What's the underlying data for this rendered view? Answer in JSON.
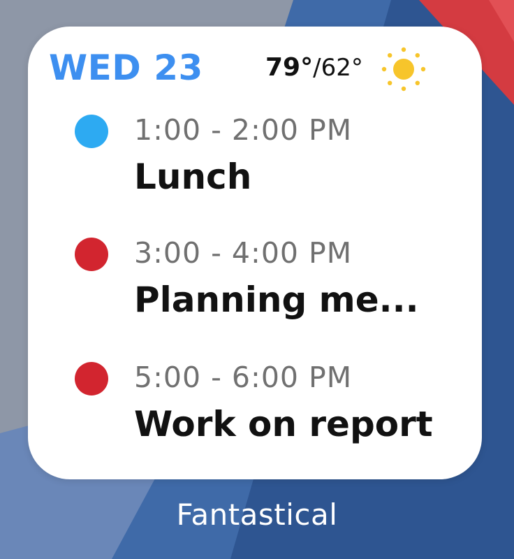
{
  "colors": {
    "accent": "#3d8ff0",
    "event_blue": "#2daaf2",
    "event_red": "#d2252f",
    "sun": "#f7c52b"
  },
  "widget": {
    "date": "WED 23",
    "weather": {
      "high": "79°",
      "low": "/62°",
      "icon": "sun-icon"
    },
    "events": [
      {
        "time": "1:00 - 2:00 PM",
        "title": "Lunch",
        "color": "#2daaf2"
      },
      {
        "time": "3:00 - 4:00 PM",
        "title": "Planning me...",
        "color": "#d2252f"
      },
      {
        "time": "5:00 - 6:00 PM",
        "title": "Work on report",
        "color": "#d2252f"
      }
    ]
  },
  "app_label": "Fantastical"
}
